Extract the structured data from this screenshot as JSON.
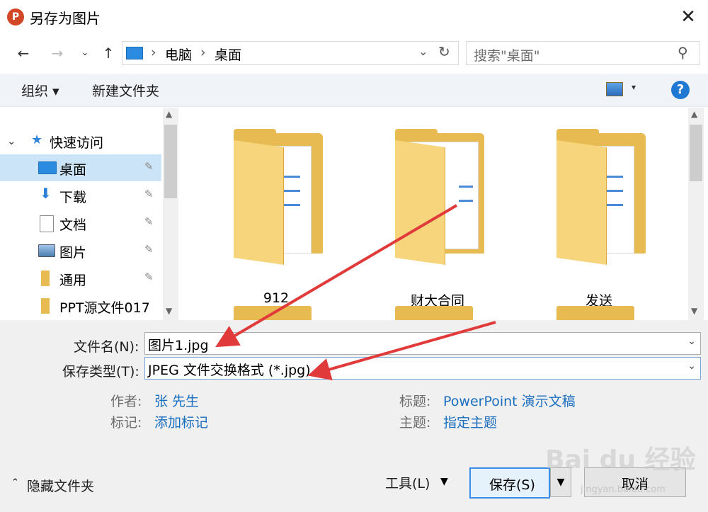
{
  "window": {
    "title": "另存为图片",
    "app_icon_letter": "P",
    "close_glyph": "✕"
  },
  "nav": {
    "back_glyph": "←",
    "forward_glyph": "→",
    "recent_glyph": "⌄",
    "up_glyph": "↑",
    "breadcrumb": [
      "电脑",
      "桌面"
    ],
    "breadcrumb_sep": "›",
    "refresh_glyph": "↻",
    "search_placeholder": "搜索\"桌面\"",
    "search_glyph": "⚲"
  },
  "toolbar": {
    "organize_label": "组织 ▾",
    "new_folder_label": "新建文件夹",
    "view_dd_glyph": "▾",
    "help_glyph": "?"
  },
  "sidebar": {
    "quick_access_label": "快速访问",
    "items": [
      {
        "label": "桌面",
        "icon": "desktop-icon",
        "pinned": true,
        "selected": true
      },
      {
        "label": "下载",
        "icon": "download-icon",
        "pinned": true
      },
      {
        "label": "文档",
        "icon": "document-icon",
        "pinned": true
      },
      {
        "label": "图片",
        "icon": "picture-icon",
        "pinned": true
      },
      {
        "label": "通用",
        "icon": "folder-icon",
        "pinned": true
      },
      {
        "label": "PPT源文件017",
        "icon": "folder-icon",
        "pinned": false
      }
    ],
    "pin_glyph": "📌"
  },
  "files": [
    {
      "name": "912",
      "icon": "folder-icon"
    },
    {
      "name": "财大合同",
      "icon": "folder-icon"
    },
    {
      "name": "发送",
      "icon": "folder-icon"
    }
  ],
  "form": {
    "filename_label": "文件名(N):",
    "filename_value": "图片1.jpg",
    "filetype_label": "保存类型(T):",
    "filetype_value": "JPEG 文件交换格式 (*.jpg)",
    "author_label": "作者:",
    "author_value": "张 先生",
    "tags_label": "标记:",
    "tags_value": "添加标记",
    "title_label": "标题:",
    "title_value": "PowerPoint 演示文稿",
    "subject_label": "主题:",
    "subject_value": "指定主题"
  },
  "footer": {
    "hide_folders_label": "隐藏文件夹",
    "tools_label": "工具(L)",
    "save_label": "保存(S)",
    "cancel_label": "取消"
  },
  "watermark": {
    "text": "Bai du 经验",
    "sub": "jingyan.baidu.com"
  },
  "colors": {
    "accent": "#1f78d1",
    "selection": "#cce4f7",
    "folder": "#e8bb52",
    "annotation_arrow": "#e03a3a"
  }
}
